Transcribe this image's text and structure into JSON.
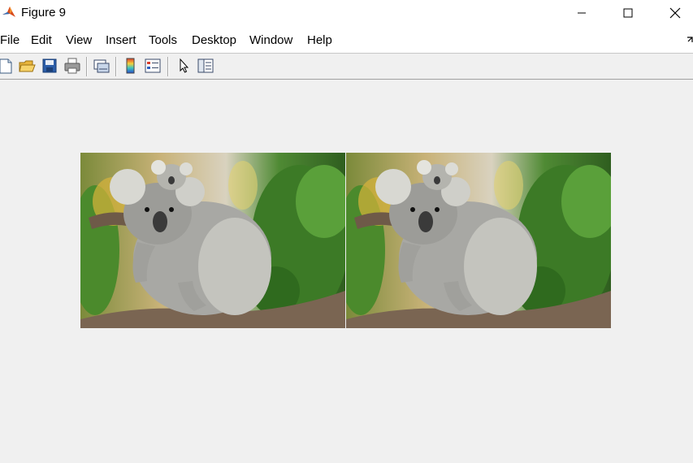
{
  "window": {
    "title": "Figure 9",
    "app_icon": "matlab-icon",
    "controls": [
      "minimize-icon",
      "maximize-icon",
      "close-icon"
    ]
  },
  "menu": {
    "items": [
      "File",
      "Edit",
      "View",
      "Insert",
      "Tools",
      "Desktop",
      "Window",
      "Help"
    ]
  },
  "toolbar": {
    "buttons": [
      "new-figure-icon",
      "open-file-icon",
      "save-icon",
      "print-icon",
      "link-plot-icon",
      "insert-colorbar-icon",
      "insert-legend-icon",
      "edit-plot-cursor-icon",
      "property-inspector-icon"
    ]
  },
  "figure": {
    "images": [
      {
        "subject": "koala-photo-left"
      },
      {
        "subject": "koala-photo-right"
      }
    ],
    "colors": {
      "figure_background": "#f0f0f0",
      "foliage": "#3d7a2a",
      "koala_fur": "#a8a8a4",
      "branch": "#6e5a48"
    }
  }
}
